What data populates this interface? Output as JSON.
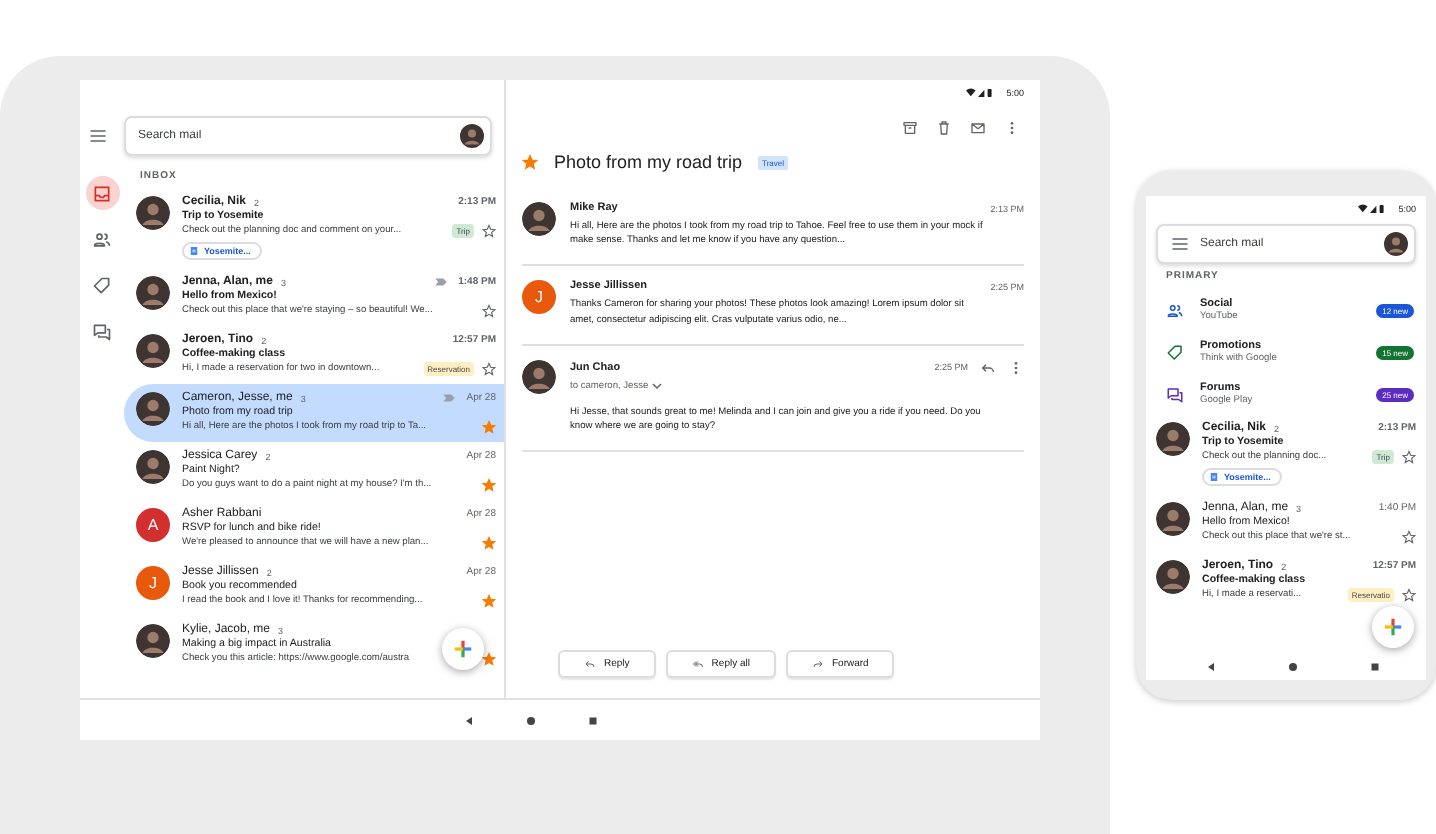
{
  "tablet": {
    "status_time": "5:00",
    "search": {
      "placeholder": "Search mail"
    },
    "rail": [
      {
        "selected": true
      },
      {
        "selected": false
      },
      {
        "selected": false
      },
      {
        "selected": false
      }
    ],
    "list_heading": "INBOX",
    "threads": [
      {
        "sender": "Cecilia, Nik",
        "count": "2",
        "subject": "Trip to Yosemite",
        "snippet": "Check out the planning doc and comment on your...",
        "time": "2:13 PM",
        "unread": true,
        "important": false,
        "selected": false,
        "starred": false,
        "tag": {
          "text": "Trip",
          "color": "#ceead6"
        },
        "attachment": "Yosemite...",
        "avatar": {
          "kind": "photo"
        }
      },
      {
        "sender": "Jenna, Alan, me",
        "count": "3",
        "subject": "Hello from Mexico!",
        "snippet": "Check out this place that we're staying – so beautiful! We...",
        "time": "1:48 PM",
        "unread": true,
        "important": true,
        "selected": false,
        "starred": false,
        "avatar": {
          "kind": "photo"
        }
      },
      {
        "sender": "Jeroen, Tino",
        "count": "2",
        "subject": "Coffee-making class",
        "snippet": "Hi, I made a reservation for two in downtown...",
        "time": "12:57 PM",
        "unread": true,
        "important": false,
        "selected": false,
        "starred": false,
        "tag": {
          "text": "Reservation",
          "color": "#feefc3"
        },
        "avatar": {
          "kind": "photo"
        }
      },
      {
        "sender": "Cameron, Jesse, me",
        "count": "3",
        "subject": "Photo from my road trip",
        "snippet": "Hi all, Here are the photos I took from my road trip to Ta...",
        "time": "Apr 28",
        "unread": false,
        "important": true,
        "selected": true,
        "starred": true,
        "avatar": {
          "kind": "photo"
        }
      },
      {
        "sender": "Jessica Carey",
        "count": "2",
        "subject": "Paint Night?",
        "snippet": "Do you guys want to do a paint night at my house? I'm th...",
        "time": "Apr 28",
        "unread": false,
        "important": false,
        "selected": false,
        "starred": true,
        "avatar": {
          "kind": "photo"
        }
      },
      {
        "sender": "Asher Rabbani",
        "subject": "RSVP for lunch and bike ride!",
        "snippet": "We're pleased to announce that we will have a new plan...",
        "time": "Apr 28",
        "unread": false,
        "important": false,
        "selected": false,
        "starred": true,
        "avatar": {
          "kind": "letter",
          "letter": "A",
          "color": "#d32f2f"
        }
      },
      {
        "sender": "Jesse Jillissen",
        "count": "2",
        "subject": "Book you recommended",
        "snippet": "I read the book and I love it! Thanks for recommending...",
        "time": "Apr 28",
        "unread": false,
        "important": false,
        "selected": false,
        "starred": true,
        "avatar": {
          "kind": "letter",
          "letter": "J",
          "color": "#e8590c"
        }
      },
      {
        "sender": "Kylie, Jacob, me",
        "count": "3",
        "subject": "Making a big impact in Australia",
        "snippet": "Check you this article: https://www.google.com/austra",
        "unread": false,
        "important": false,
        "selected": false,
        "starred": true,
        "avatar": {
          "kind": "photo"
        }
      }
    ],
    "conversation": {
      "subject": "Photo from my road trip",
      "label": "Travel",
      "starred": true,
      "messages": [
        {
          "sender": "Mike Ray",
          "time": "2:13 PM",
          "expanded": false,
          "body": "Hi all, Here are the photos I took from my road trip to Tahoe. Feel free to use them in your mock if make sense. Thanks and let me know if you have any question...",
          "avatar": {
            "kind": "photo"
          }
        },
        {
          "sender": "Jesse Jillissen",
          "time": "2:25 PM",
          "expanded": false,
          "body": "Thanks Cameron for sharing your photos! These photos look amazing! Lorem ipsum dolor sit amet, consectetur adipiscing elit. Cras vulputate varius odio, ne...",
          "avatar": {
            "kind": "letter",
            "letter": "J",
            "color": "#e8590c"
          }
        },
        {
          "sender": "Jun Chao",
          "time": "2:25 PM",
          "expanded": true,
          "recipients": "to cameron, Jesse",
          "body": "Hi Jesse, that sounds great to me! Melinda and I can join and give you a ride if you need. Do you know where we are going to stay?",
          "avatar": {
            "kind": "photo"
          }
        }
      ],
      "actions": [
        "Reply",
        "Reply all",
        "Forward"
      ]
    }
  },
  "phone": {
    "status_time": "5:00",
    "search": {
      "placeholder": "Search mail"
    },
    "section_heading": "PRIMARY",
    "categories": [
      {
        "name": "Social",
        "source": "YouTube",
        "badge": "12 new",
        "color": "#1a56d6"
      },
      {
        "name": "Promotions",
        "source": "Think with Google",
        "badge": "15 new",
        "color": "#137333"
      },
      {
        "name": "Forums",
        "source": "Google Play",
        "badge": "25 new",
        "color": "#5b2bc2"
      }
    ],
    "threads": [
      {
        "sender": "Cecilia, Nik",
        "count": "2",
        "subject": "Trip to Yosemite",
        "snippet": "Check out the planning doc...",
        "time": "2:13 PM",
        "unread": true,
        "important": false,
        "selected": false,
        "starred": false,
        "tag": {
          "text": "Trip",
          "color": "#ceead6"
        },
        "attachment": "Yosemite...",
        "avatar": {
          "kind": "photo"
        }
      },
      {
        "sender": "Jenna, Alan, me",
        "count": "3",
        "subject": "Hello from Mexico!",
        "snippet": "Check out this place that we're st...",
        "time": "1:40 PM",
        "unread": false,
        "important": false,
        "selected": false,
        "starred": false,
        "avatar": {
          "kind": "photo"
        }
      },
      {
        "sender": "Jeroen, Tino",
        "count": "2",
        "subject": "Coffee-making class",
        "snippet": "Hi, I made a reservati...",
        "time": "12:57 PM",
        "unread": true,
        "important": false,
        "selected": false,
        "starred": false,
        "tag": {
          "text": "Reservatio",
          "color": "#feefc3"
        },
        "avatar": {
          "kind": "photo"
        }
      }
    ]
  }
}
